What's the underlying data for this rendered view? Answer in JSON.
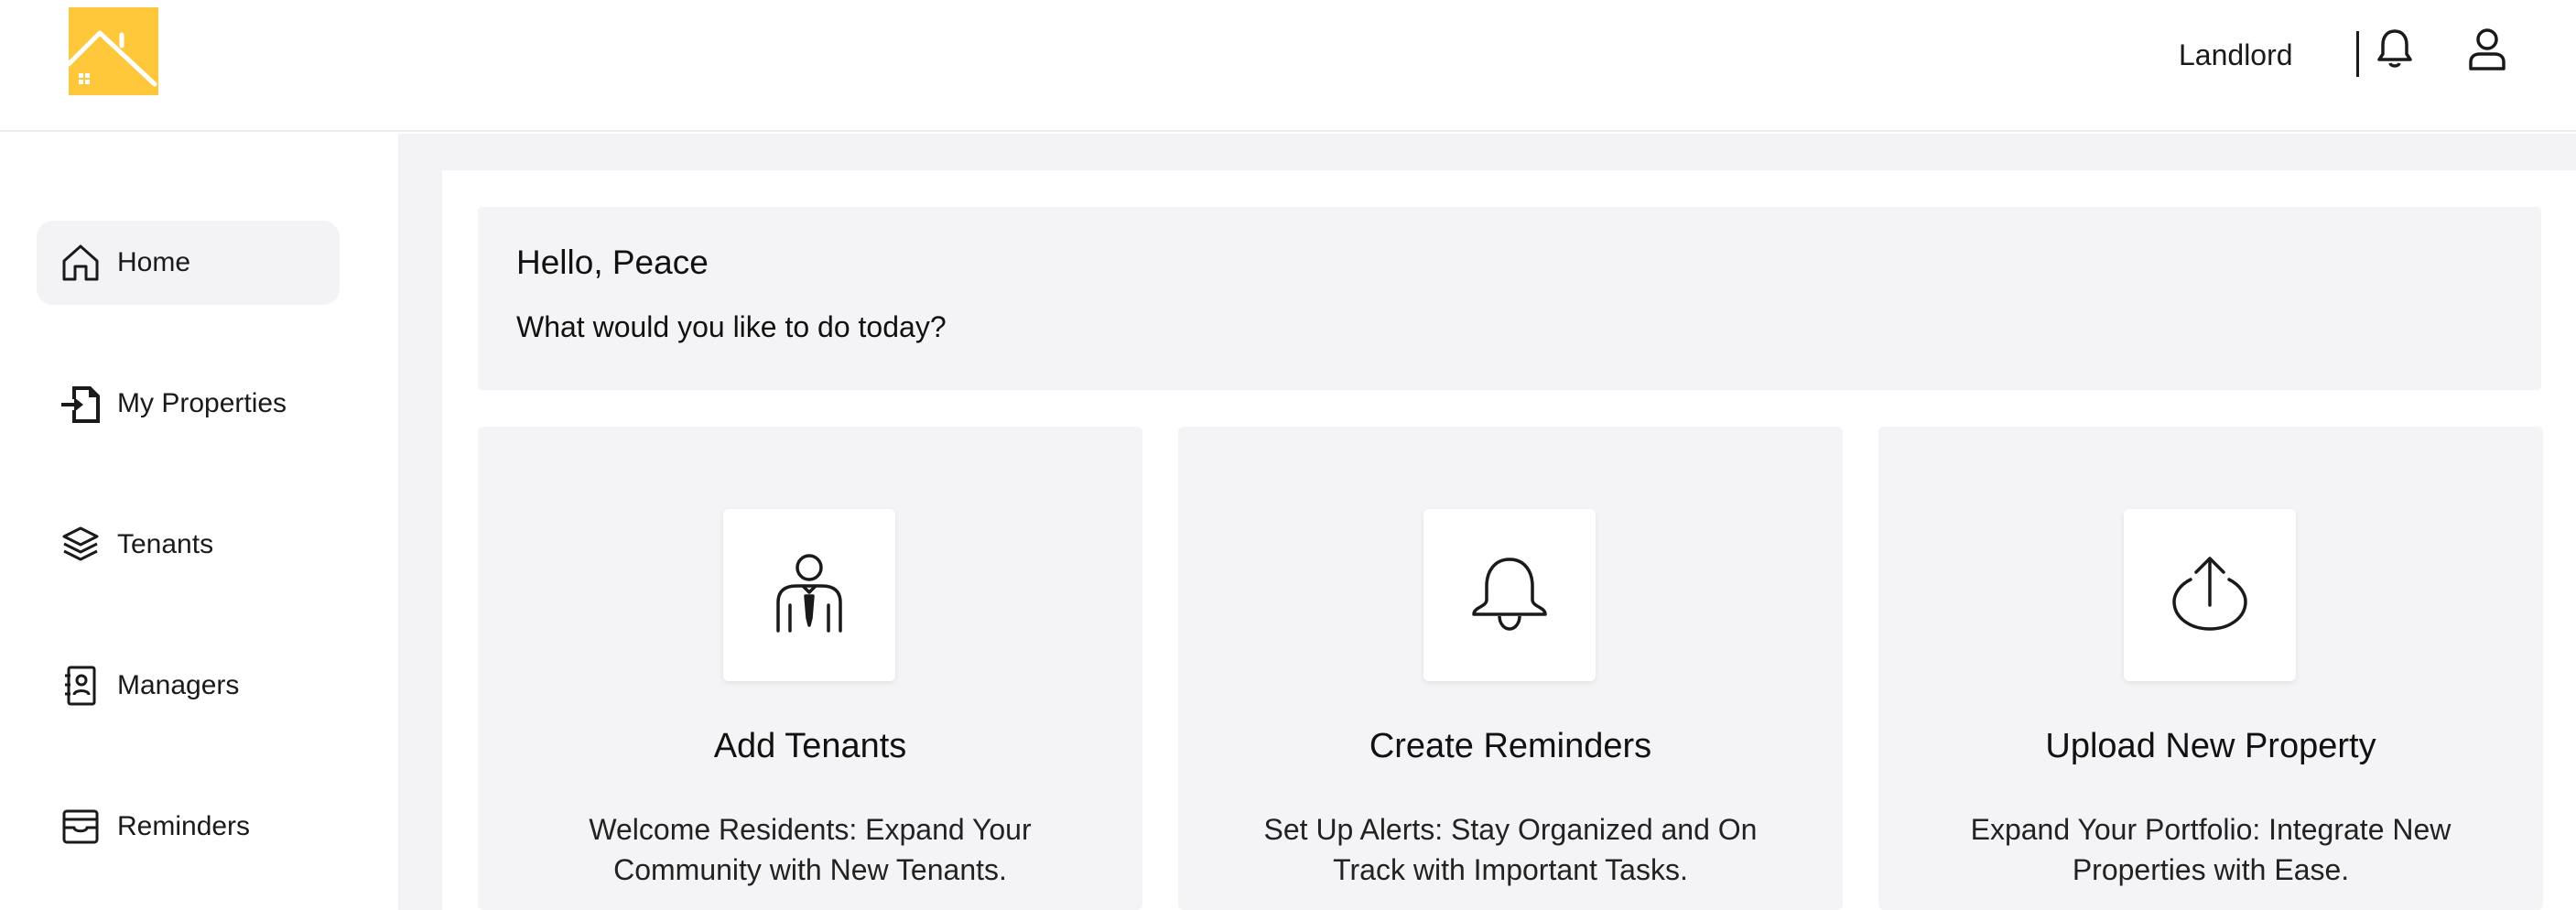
{
  "header": {
    "role_label": "Landlord",
    "icons": {
      "logo": "house-logo-icon",
      "notifications": "bell-icon",
      "profile": "user-icon"
    },
    "colors": {
      "logo": "#FFC83A"
    }
  },
  "sidebar": {
    "items": [
      {
        "label": "Home",
        "icon": "home-icon",
        "active": true
      },
      {
        "label": "My Properties",
        "icon": "file-import-icon",
        "active": false
      },
      {
        "label": "Tenants",
        "icon": "layers-icon",
        "active": false
      },
      {
        "label": "Managers",
        "icon": "contact-book-icon",
        "active": false
      },
      {
        "label": "Reminders",
        "icon": "inbox-icon",
        "active": false
      }
    ]
  },
  "greeting": {
    "title": "Hello, Peace",
    "subtitle": "What would you like to do today?"
  },
  "cards": [
    {
      "title": "Add Tenants",
      "description": "Welcome Residents: Expand Your Community with New Tenants.",
      "icon": "businessman-icon"
    },
    {
      "title": "Create Reminders",
      "description": "Set Up Alerts: Stay Organized and On Track with Important Tasks.",
      "icon": "bell-icon"
    },
    {
      "title": "Upload New Property",
      "description": "Expand Your Portfolio: Integrate New Properties with Ease.",
      "icon": "upload-icon"
    }
  ]
}
